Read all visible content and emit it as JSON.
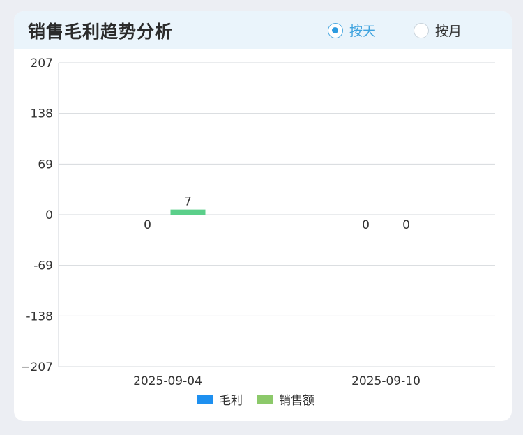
{
  "header": {
    "title": "销售毛利趋势分析",
    "options": [
      {
        "label": "按天",
        "checked": true
      },
      {
        "label": "按月",
        "checked": false
      }
    ]
  },
  "chart_data": {
    "type": "bar",
    "categories": [
      "2025-09-04",
      "2025-09-10"
    ],
    "series": [
      {
        "name": "毛利",
        "color": "#1e90f0",
        "values": [
          0,
          0
        ]
      },
      {
        "name": "销售额",
        "color": "#8cc96a",
        "values": [
          7,
          0
        ]
      }
    ],
    "data_labels": [
      [
        "0",
        "7"
      ],
      [
        "0",
        "0"
      ]
    ],
    "ylim": [
      -207,
      207
    ],
    "yticks": [
      207,
      138,
      69,
      0,
      -69,
      -138,
      -207
    ],
    "ytick_labels": [
      "207",
      "138",
      "69",
      "0",
      "-69",
      "-138",
      "−207"
    ],
    "grid": true,
    "legend_position": "bottom",
    "bar_highlight_color": "#5bcf8a"
  }
}
